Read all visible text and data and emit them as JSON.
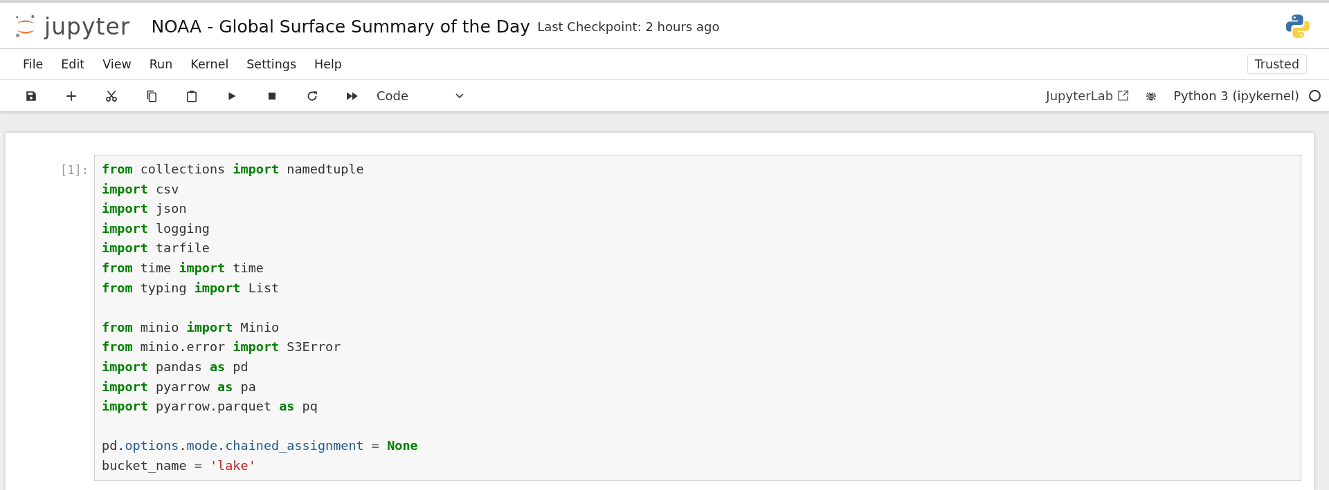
{
  "header": {
    "logo_text": "jupyter",
    "title": "NOAA - Global Surface Summary of the Day",
    "checkpoint": "Last Checkpoint: 2 hours ago"
  },
  "menu": [
    {
      "label": "File"
    },
    {
      "label": "Edit"
    },
    {
      "label": "View"
    },
    {
      "label": "Run"
    },
    {
      "label": "Kernel"
    },
    {
      "label": "Settings"
    },
    {
      "label": "Help"
    }
  ],
  "trusted": "Trusted",
  "toolbar": {
    "buttons": [
      {
        "kind": "save"
      },
      {
        "kind": "add"
      },
      {
        "kind": "cut"
      },
      {
        "kind": "copy"
      },
      {
        "kind": "paste"
      },
      {
        "kind": "run"
      },
      {
        "kind": "stop"
      },
      {
        "kind": "restart"
      },
      {
        "kind": "run-all"
      }
    ],
    "cell_type": "Code",
    "lab_link": "JupyterLab",
    "kernel": "Python 3 (ipykernel)",
    "kernel_busy": false
  },
  "cells": [
    {
      "prompt": "[1]:",
      "blocks": [
        [
          [
            {
              "kind": "keyword",
              "text": "from"
            },
            {
              "kind": "name",
              "text": " collections "
            },
            {
              "kind": "keyword",
              "text": "import"
            },
            {
              "kind": "name",
              "text": " namedtuple"
            }
          ],
          [
            {
              "kind": "keyword",
              "text": "import"
            },
            {
              "kind": "name",
              "text": " csv"
            }
          ],
          [
            {
              "kind": "keyword",
              "text": "import"
            },
            {
              "kind": "name",
              "text": " json"
            }
          ],
          [
            {
              "kind": "keyword",
              "text": "import"
            },
            {
              "kind": "name",
              "text": " logging"
            }
          ],
          [
            {
              "kind": "keyword",
              "text": "import"
            },
            {
              "kind": "name",
              "text": " tarfile"
            }
          ],
          [
            {
              "kind": "keyword",
              "text": "from"
            },
            {
              "kind": "name",
              "text": " time "
            },
            {
              "kind": "keyword",
              "text": "import"
            },
            {
              "kind": "name",
              "text": " time"
            }
          ],
          [
            {
              "kind": "keyword",
              "text": "from"
            },
            {
              "kind": "name",
              "text": " typing "
            },
            {
              "kind": "keyword",
              "text": "import"
            },
            {
              "kind": "name",
              "text": " List"
            }
          ]
        ],
        [
          [
            {
              "kind": "keyword",
              "text": "from"
            },
            {
              "kind": "name",
              "text": " minio "
            },
            {
              "kind": "keyword",
              "text": "import"
            },
            {
              "kind": "name",
              "text": " Minio"
            }
          ],
          [
            {
              "kind": "keyword",
              "text": "from"
            },
            {
              "kind": "name",
              "text": " minio.error "
            },
            {
              "kind": "keyword",
              "text": "import"
            },
            {
              "kind": "name",
              "text": " S3Error"
            }
          ],
          [
            {
              "kind": "keyword",
              "text": "import"
            },
            {
              "kind": "name",
              "text": " pandas "
            },
            {
              "kind": "keyword",
              "text": "as"
            },
            {
              "kind": "name",
              "text": " pd"
            }
          ],
          [
            {
              "kind": "keyword",
              "text": "import"
            },
            {
              "kind": "name",
              "text": " pyarrow "
            },
            {
              "kind": "keyword",
              "text": "as"
            },
            {
              "kind": "name",
              "text": " pa"
            }
          ],
          [
            {
              "kind": "keyword",
              "text": "import"
            },
            {
              "kind": "name",
              "text": " pyarrow.parquet "
            },
            {
              "kind": "keyword",
              "text": "as"
            },
            {
              "kind": "name",
              "text": " pq"
            }
          ]
        ],
        [
          [
            {
              "kind": "name",
              "text": "pd."
            },
            {
              "kind": "attr",
              "text": "options"
            },
            {
              "kind": "name",
              "text": "."
            },
            {
              "kind": "attr",
              "text": "mode"
            },
            {
              "kind": "name",
              "text": "."
            },
            {
              "kind": "attr",
              "text": "chained_assignment"
            },
            {
              "kind": "operator",
              "text": " = "
            },
            {
              "kind": "keyword",
              "text": "None"
            }
          ],
          [
            {
              "kind": "name",
              "text": "bucket_name"
            },
            {
              "kind": "operator",
              "text": " = "
            },
            {
              "kind": "string",
              "text": "'lake'"
            }
          ]
        ]
      ]
    }
  ]
}
